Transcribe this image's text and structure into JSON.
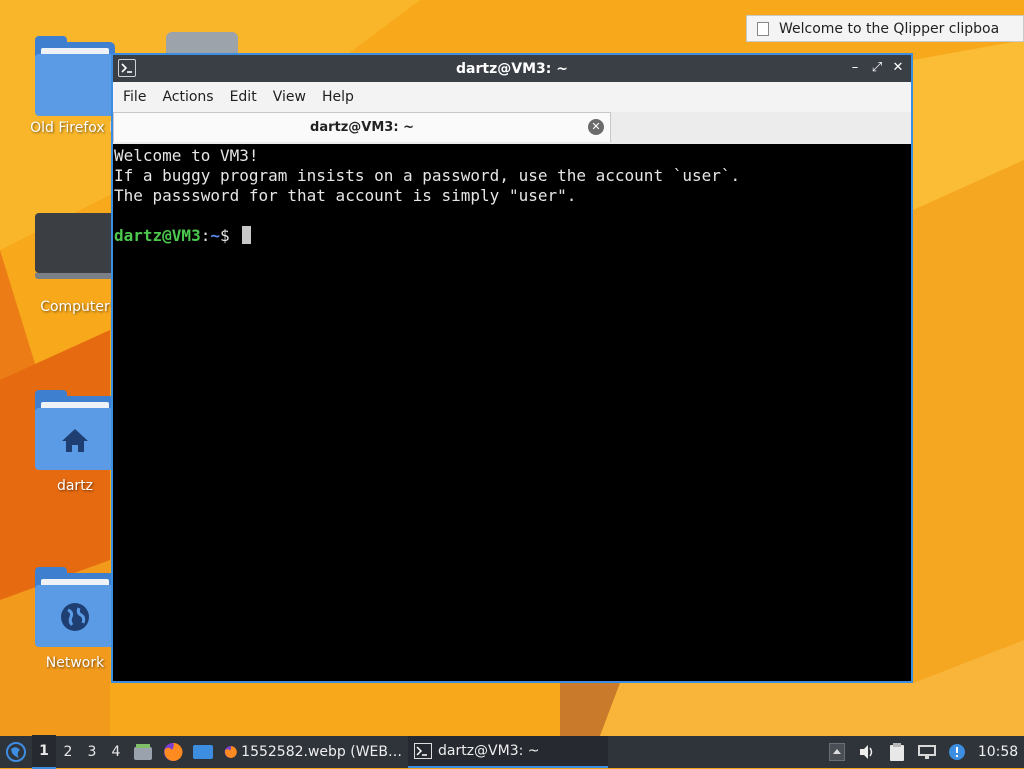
{
  "desktop": {
    "icons": [
      {
        "label": "Old Firefox D",
        "icon": "folder-icon"
      },
      {
        "label": "Computer",
        "icon": "computer-icon"
      },
      {
        "label": "dartz",
        "icon": "home-folder-icon"
      },
      {
        "label": "Network",
        "icon": "network-folder-icon"
      }
    ]
  },
  "notification": {
    "text": "Welcome to the Qlipper clipboa",
    "icon": "clipboard-icon"
  },
  "window": {
    "title": "dartz@VM3: ~",
    "controls": {
      "minimize": "–",
      "maximize": "⤢",
      "close": "✕"
    },
    "menu": [
      "File",
      "Actions",
      "Edit",
      "View",
      "Help"
    ],
    "tab": {
      "label": "dartz@VM3: ~",
      "close": "✕"
    },
    "terminal": {
      "lines": [
        "Welcome to VM3!",
        "If a buggy program insists on a password, use the account `user`.",
        "The passsword for that account is simply \"user\".",
        ""
      ],
      "prompt": {
        "user_host": "dartz@VM3",
        "sep": ":",
        "path": "~",
        "symbol": "$ "
      }
    }
  },
  "taskbar": {
    "workspaces": [
      "1",
      "2",
      "3",
      "4"
    ],
    "active_workspace": "1",
    "tasks": [
      {
        "label": "1552582.webp (WEB…",
        "icon": "firefox-icon",
        "active": false
      },
      {
        "label": "dartz@VM3: ~",
        "icon": "terminal-icon",
        "active": true
      }
    ],
    "clock": "10:58"
  },
  "colors": {
    "accent": "#3d8ee0",
    "prompt_user": "#4cc84c",
    "prompt_path": "#5b8cf0",
    "taskbar": "#2f343b"
  }
}
